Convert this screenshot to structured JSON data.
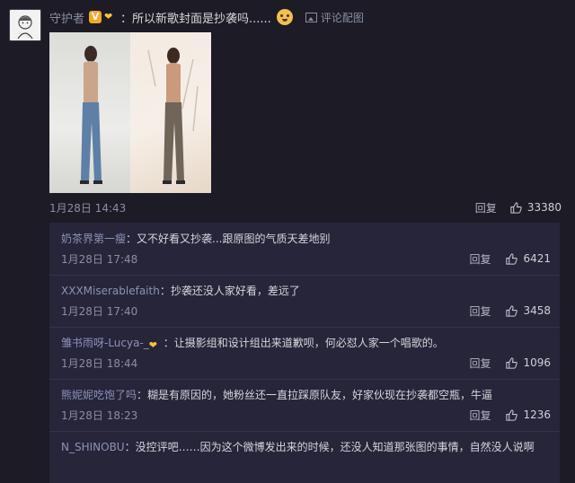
{
  "post": {
    "username": "守护者",
    "verified_badge": "V",
    "text": "：所以新歌封面是抄袭吗......",
    "pic_label": "评论配图",
    "time": "1月28日 14:43",
    "reply_label": "回复",
    "likes": "33380",
    "emoji_name": "doge-emoji"
  },
  "comments": [
    {
      "user": "奶茶界第一瘦",
      "text": "：又不好看又抄袭...跟原图的气质天差地别",
      "time": "1月28日 17:48",
      "reply": "回复",
      "likes": "6421"
    },
    {
      "user": "XXXMiserablefaith",
      "text": "：抄袭还没人家好看，差远了",
      "time": "1月28日 17:40",
      "reply": "回复",
      "likes": "3458"
    },
    {
      "user": "雏书雨呀-Lucya-_",
      "text": "：让摄影组和设计组出来道歉呗，何必怼人家一个唱歌的。",
      "time": "1月28日 18:44",
      "reply": "回复",
      "likes": "1096"
    },
    {
      "user": "熊妮妮吃饱了吗",
      "text": "：糊是有原因的，她粉丝还一直拉踩原队友，好家伙现在抄袭都空瓶，牛逼",
      "time": "1月28日 18:23",
      "reply": "回复",
      "likes": "1236"
    },
    {
      "user": "N_SHINOBU",
      "text": "：没控评吧……因为这个微博发出来的时候，还没人知道那张图的事情，自然没人说啊",
      "time": "",
      "reply": "",
      "likes": ""
    }
  ],
  "colors": {
    "background": "#1c1b26",
    "comment_panel": "#26253a",
    "username": "#8d92b6"
  }
}
